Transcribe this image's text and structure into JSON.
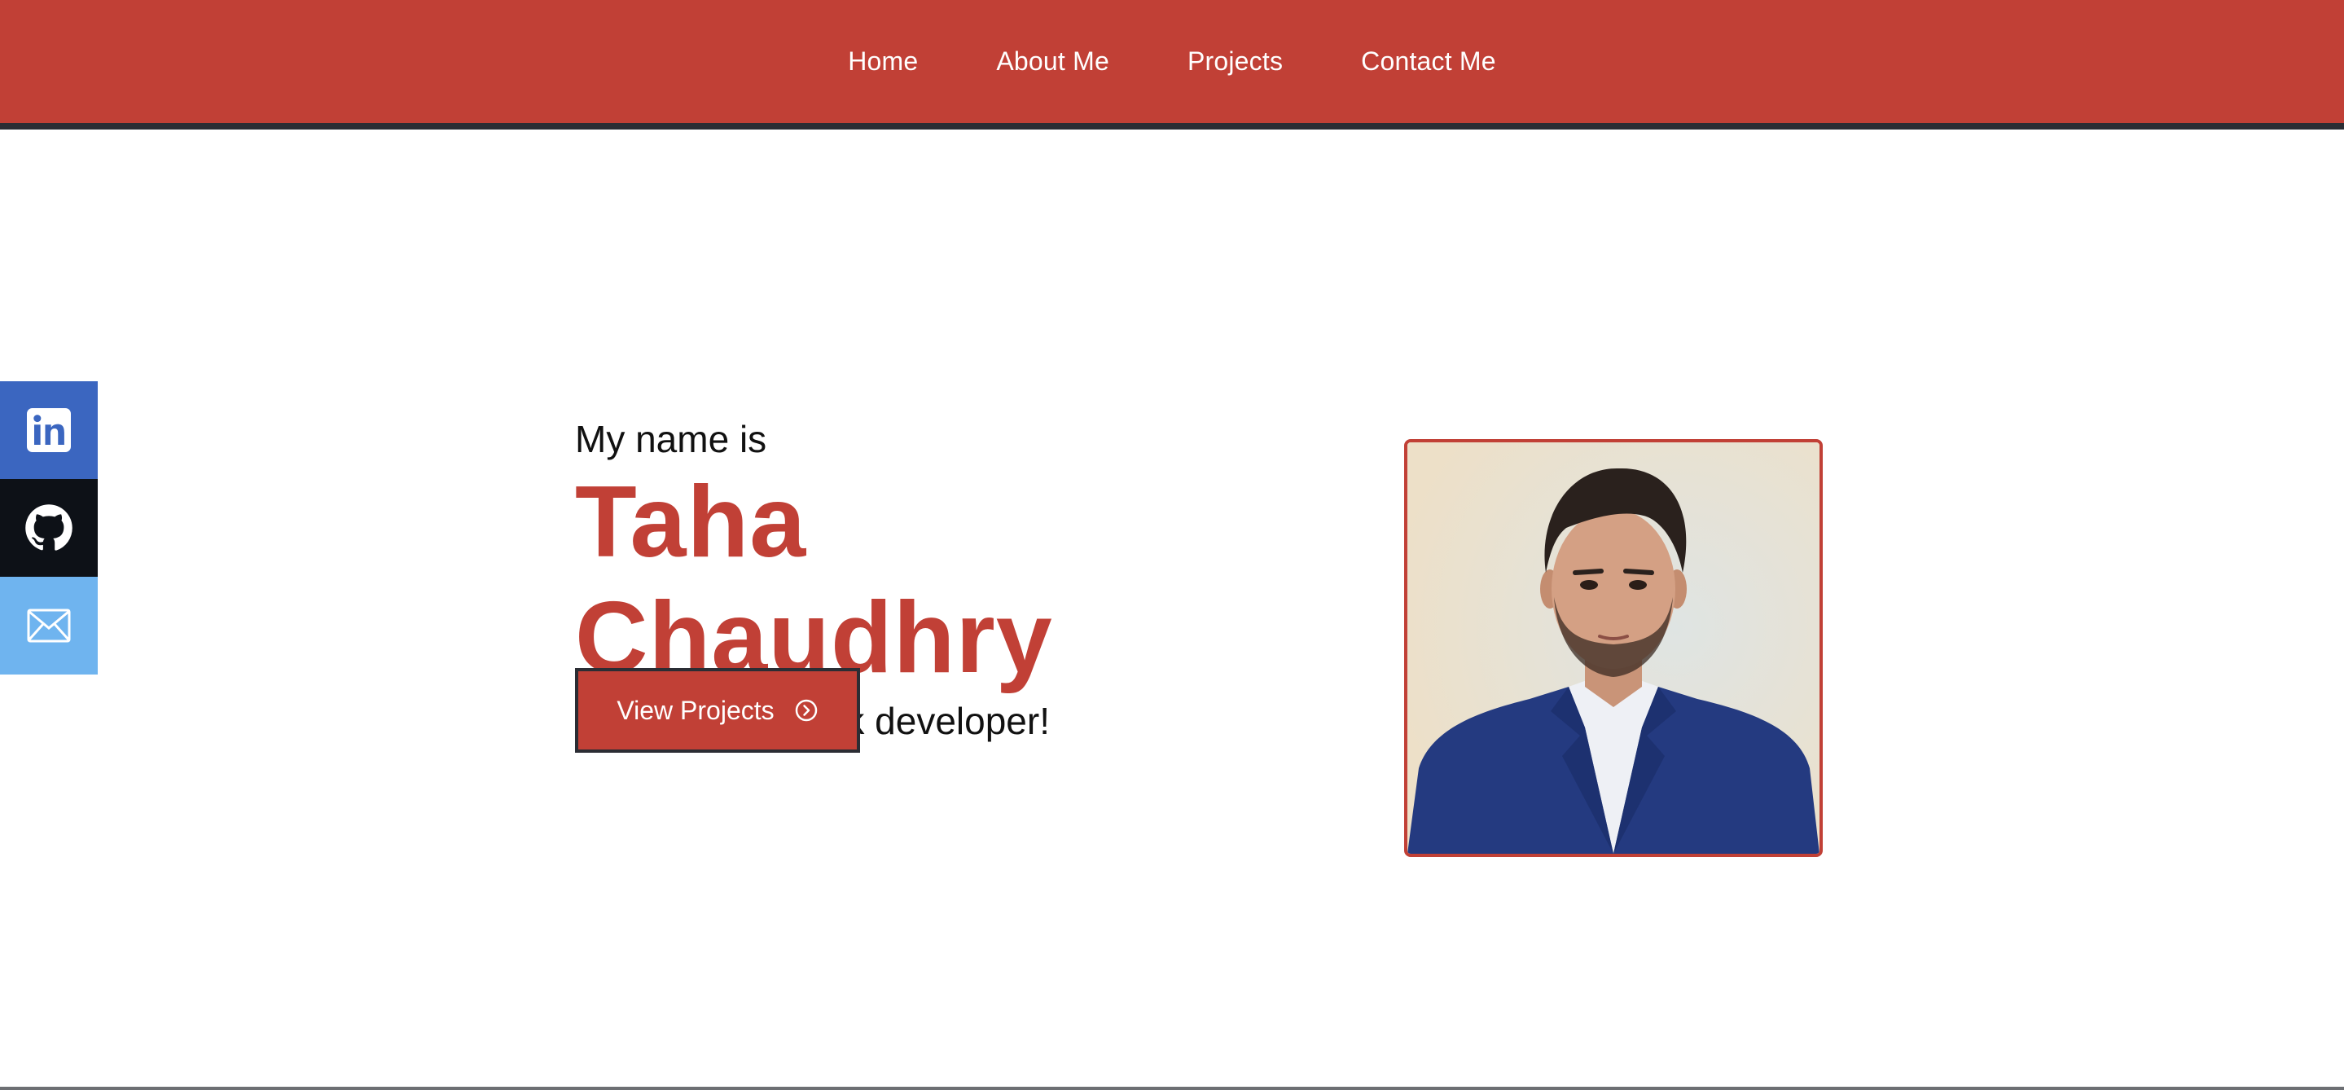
{
  "nav": {
    "items": [
      {
        "label": "Home"
      },
      {
        "label": "About Me"
      },
      {
        "label": "Projects"
      },
      {
        "label": "Contact Me"
      }
    ]
  },
  "social": {
    "items": [
      {
        "name": "linkedin-icon",
        "color": "#3b66c0"
      },
      {
        "name": "github-icon",
        "color": "#0d1117"
      },
      {
        "name": "email-icon",
        "color": "#6fb4ef"
      }
    ]
  },
  "hero": {
    "intro": "My name is",
    "name": "Taha Chaudhry",
    "tagline": "and im a fullstack developer!",
    "button_label": "View Projects",
    "button_icon": "chevron-right-circle-icon"
  },
  "theme": {
    "accent": "#c14036",
    "dark": "#2b2d34"
  }
}
